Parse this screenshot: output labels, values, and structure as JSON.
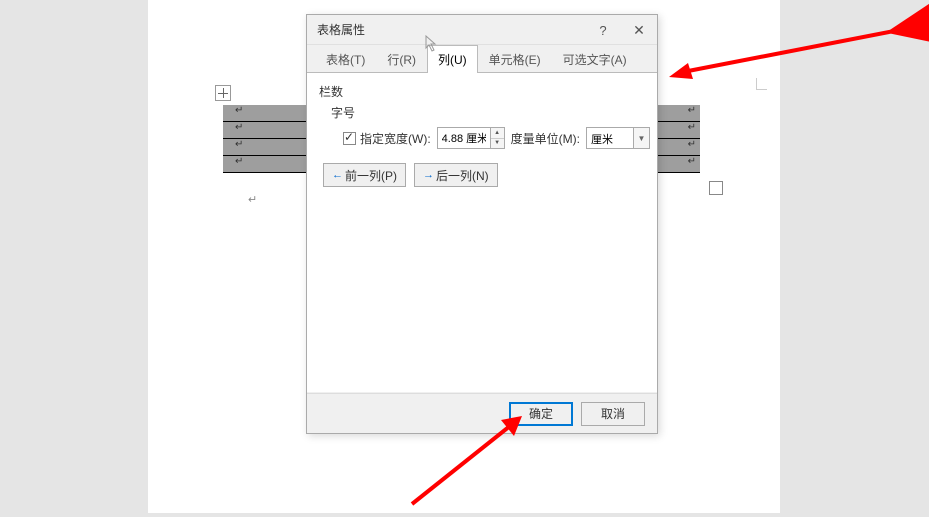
{
  "dialog": {
    "title": "表格属性",
    "tabs": {
      "table": "表格(T)",
      "row": "行(R)",
      "column": "列(U)",
      "cell": "单元格(E)",
      "alttext": "可选文字(A)"
    },
    "column_panel": {
      "group_label": "栏数",
      "sub_label": "字号",
      "specify_width_label": "指定宽度(W):",
      "width_value": "4.88 厘米",
      "measure_unit_label": "度量单位(M):",
      "measure_unit_value": "厘米"
    },
    "nav": {
      "prev": "前一列(P)",
      "next": "后一列(N)"
    },
    "buttons": {
      "ok": "确定",
      "cancel": "取消"
    },
    "help": "?",
    "close": "✕"
  }
}
